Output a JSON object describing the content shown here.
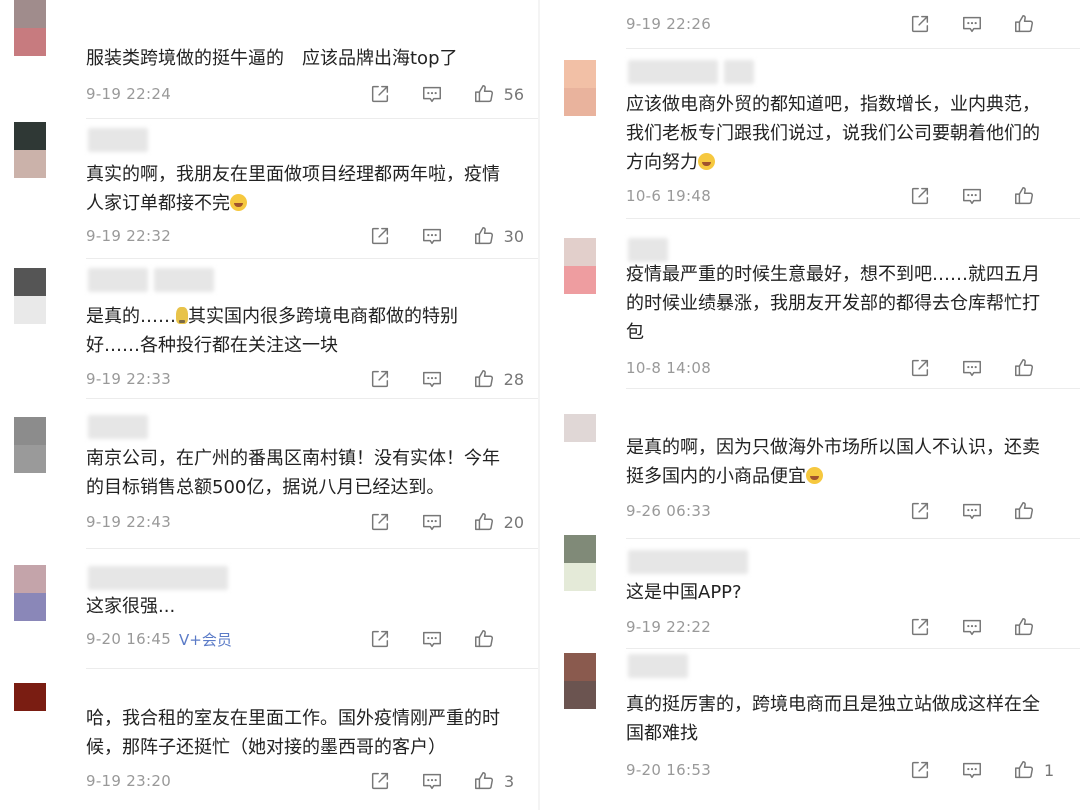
{
  "left": {
    "comments": [
      {
        "text": "服装类跨境做的挺牛逼的　应该品牌出海top了",
        "time": "9-19 22:24",
        "likes": "56",
        "avatar_colors": [
          "#a08c8c",
          "#c77b7f"
        ]
      },
      {
        "text": "真实的啊，我朋友在里面做项目经理都两年啦，疫情人家订单都接不完",
        "emoji": "grin-sweat",
        "time": "9-19 22:32",
        "likes": "30",
        "avatar_colors": [
          "#2f3835",
          "#cbb2aa"
        ]
      },
      {
        "text_before": "是真的……",
        "emoji": "lightbulb",
        "text": "其实国内很多跨境电商都做的特别好……各种投行都在关注这一块",
        "time": "9-19 22:33",
        "likes": "28",
        "avatar_colors": [
          "#555555",
          "#e9e9e9"
        ]
      },
      {
        "text": "南京公司，在广州的番禺区南村镇！没有实体！今年的目标销售总额500亿，据说八月已经达到。",
        "time": "9-19 22:43",
        "likes": "20",
        "avatar_colors": [
          "#8c8c8c",
          "#9a9a9a"
        ]
      },
      {
        "text": "这家很强...",
        "time": "9-20 16:45",
        "vip": "V+会员",
        "likes": "",
        "avatar_colors": [
          "#c4a4aa",
          "#8a87b8"
        ]
      },
      {
        "text": "哈，我合租的室友在里面工作。国外疫情刚严重的时候，那阵子还挺忙（她对接的墨西哥的客户）",
        "time": "9-19 23:20",
        "likes": "3",
        "avatar_colors": [
          "#7a1d12",
          "#ffffff"
        ]
      }
    ]
  },
  "right": {
    "top_meta": {
      "time": "9-19 22:26",
      "likes": ""
    },
    "comments": [
      {
        "text": "应该做电商外贸的都知道吧，指数增长，业内典范，我们老板专门跟我们说过，说我们公司要朝着他们的方向努力",
        "emoji": "grin-sweat",
        "time": "10-6 19:48",
        "likes": "",
        "avatar_colors": [
          "#f2c0a6",
          "#e9b39d"
        ]
      },
      {
        "text": "疫情最严重的时候生意最好，想不到吧……就四五月的时候业绩暴涨，我朋友开发部的都得去仓库帮忙打包",
        "time": "10-8 14:08",
        "likes": "",
        "avatar_colors": [
          "#e2cfcb",
          "#ee9da0"
        ]
      },
      {
        "text": "是真的啊，因为只做海外市场所以国人不认识，还卖挺多国内的小商品便宜",
        "emoji": "grin-sweat",
        "time": "9-26 06:33",
        "likes": "",
        "avatar_colors": [
          "#e0d7d6",
          "#ffffff"
        ]
      },
      {
        "text": "这是中国APP?",
        "time": "9-19 22:22",
        "likes": "",
        "avatar_colors": [
          "#808a78",
          "#e4ead8"
        ]
      },
      {
        "text": "真的挺厉害的，跨境电商而且是独立站做成这样在全国都难找",
        "time": "9-20 16:53",
        "likes": "1",
        "avatar_colors": [
          "#8a5a4e",
          "#6b5450"
        ]
      }
    ]
  },
  "icons": {
    "share": "share-icon",
    "comment": "comment-icon",
    "like": "thumbs-up-icon"
  },
  "colors": {
    "time": "#999999",
    "vip": "#5b7bc7",
    "icon": "#777777",
    "text": "#222222"
  }
}
